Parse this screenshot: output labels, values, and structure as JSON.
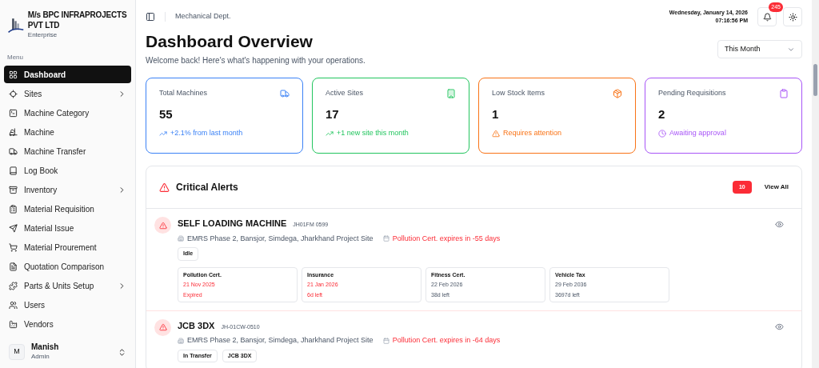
{
  "brand": {
    "name": "M/s BPC INFRAPROJECTS PVT LTD",
    "plan": "Enterprise"
  },
  "sidebar": {
    "section": "Menu",
    "items": [
      {
        "label": "Dashboard",
        "selected": true,
        "expandable": false
      },
      {
        "label": "Sites",
        "selected": false,
        "expandable": true
      },
      {
        "label": "Machine Category",
        "selected": false,
        "expandable": false
      },
      {
        "label": "Machine",
        "selected": false,
        "expandable": false
      },
      {
        "label": "Machine Transfer",
        "selected": false,
        "expandable": false
      },
      {
        "label": "Log Book",
        "selected": false,
        "expandable": false
      },
      {
        "label": "Inventory",
        "selected": false,
        "expandable": true
      },
      {
        "label": "Material Requisition",
        "selected": false,
        "expandable": false
      },
      {
        "label": "Material Issue",
        "selected": false,
        "expandable": false
      },
      {
        "label": "Material Prourement",
        "selected": false,
        "expandable": false
      },
      {
        "label": "Quotation Comparison",
        "selected": false,
        "expandable": false
      },
      {
        "label": "Parts & Units Setup",
        "selected": false,
        "expandable": true
      },
      {
        "label": "Users",
        "selected": false,
        "expandable": false
      },
      {
        "label": "Vendors",
        "selected": false,
        "expandable": false
      }
    ],
    "user": {
      "initial": "M",
      "name": "Manish",
      "role": "Admin"
    }
  },
  "header": {
    "breadcrumb": "Mechanical Dept.",
    "date": "Wednesday, January 14, 2026",
    "time": "07:16:56 PM",
    "notifications": "245"
  },
  "page": {
    "title": "Dashboard Overview",
    "subtitle": "Welcome back! Here's what's happening with your operations.",
    "period": "This Month"
  },
  "stats": [
    {
      "label": "Total Machines",
      "value": "55",
      "note": "+2.1% from last month",
      "color": "#3b82f6"
    },
    {
      "label": "Active Sites",
      "value": "17",
      "note": "+1 new site this month",
      "color": "#22c55e"
    },
    {
      "label": "Low Stock Items",
      "value": "1",
      "note": "Requires attention",
      "color": "#f97316"
    },
    {
      "label": "Pending Requisitions",
      "value": "2",
      "note": "Awaiting approval",
      "color": "#a855f7"
    }
  ],
  "alerts": {
    "title": "Critical Alerts",
    "count": "10",
    "action": "View All",
    "items": [
      {
        "name": "SELF LOADING MACHINE",
        "code": "JH01FM 0599",
        "site": "EMRS Phase 2, Bansjor, Simdega, Jharkhand Project Site",
        "warning": "Pollution Cert. expires in -55 days",
        "tags": [
          "Idle"
        ],
        "docs": [
          {
            "label": "Pollution Cert.",
            "date": "21 Nov 2025",
            "remaining": "Expired",
            "urgent": true
          },
          {
            "label": "Insurance",
            "date": "21 Jan 2026",
            "remaining": "6d left",
            "urgent": true
          },
          {
            "label": "Fitness Cert.",
            "date": "22 Feb 2026",
            "remaining": "38d left",
            "urgent": false
          },
          {
            "label": "Vehicle Tax",
            "date": "29 Feb 2036",
            "remaining": "3697d left",
            "urgent": false
          }
        ]
      },
      {
        "name": "JCB 3DX",
        "code": "JH-01CW-0510",
        "site": "EMRS Phase 2, Bansjor, Simdega, Jharkhand Project Site",
        "warning": "Pollution Cert. expires in -64 days",
        "tags": [
          "In Transfer",
          "JCB 3DX"
        ]
      }
    ]
  }
}
